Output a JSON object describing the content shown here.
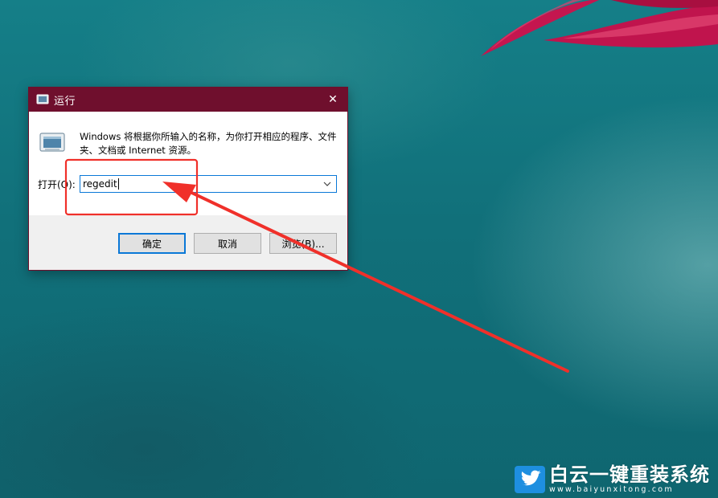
{
  "dialog": {
    "title": "运行",
    "close_label": "✕",
    "description": "Windows 将根据你所输入的名称，为你打开相应的程序、文件夹、文档或 Internet 资源。",
    "open_label": "打开(O):",
    "input_value": "regedit",
    "ok_label": "确定",
    "cancel_label": "取消",
    "browse_label": "浏览(B)..."
  },
  "watermark": {
    "brand": "白云一键重装系统",
    "url": "www.baiyunxitong.com"
  },
  "colors": {
    "titlebar": "#6f0f2d",
    "annotation": "#f0302a",
    "focus": "#0a78d7",
    "desktop": "#157f88"
  }
}
